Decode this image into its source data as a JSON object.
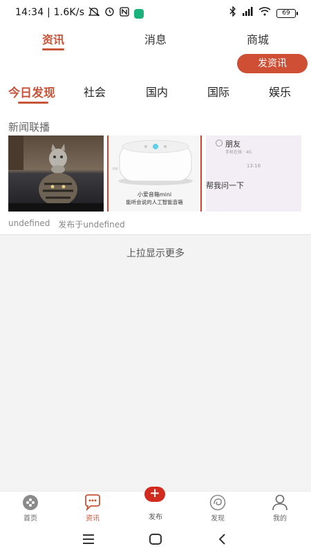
{
  "status": {
    "time": "14:34 | 1.6K/s",
    "battery": "69"
  },
  "top_tabs": [
    "资讯",
    "消息",
    "商城"
  ],
  "publish_button": "发资讯",
  "categories": [
    "今日发现",
    "社会",
    "国内",
    "国际",
    "娱乐"
  ],
  "news": {
    "section_title": "新闻联播",
    "thumb2_title": "小爱音箱mini",
    "thumb2_subtitle": "能听会说的人工智能音箱",
    "thumb2_logo": "mi",
    "thumb3_name": "朋友",
    "thumb3_status": "手机在线 · 4G",
    "thumb3_time": "13:16",
    "thumb3_msg": "帮我问一下",
    "author": "undefined",
    "published": "发布于undefined"
  },
  "load_more": "上拉显示更多",
  "bottom_tabs": {
    "home": "首页",
    "news": "资讯",
    "publish": "发布",
    "discover": "发现",
    "mine": "我的"
  },
  "colors": {
    "accent": "#c8543a",
    "button": "#cf4f34",
    "plus": "#d02b1e"
  }
}
